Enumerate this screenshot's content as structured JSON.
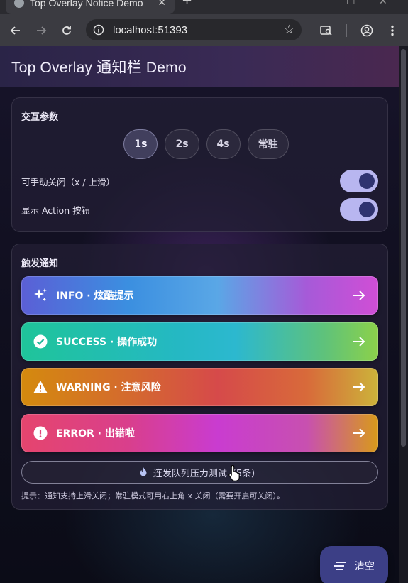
{
  "browser": {
    "tab_title": "Top Overlay Notice Demo",
    "tab_close": "✕",
    "new_tab": "+",
    "url": "localhost:51393"
  },
  "app": {
    "title": "Top Overlay 通知栏 Demo"
  },
  "params_card": {
    "title": "交互参数",
    "durations": [
      {
        "label": "1s",
        "selected": true
      },
      {
        "label": "2s",
        "selected": false
      },
      {
        "label": "4s",
        "selected": false
      },
      {
        "label": "常驻",
        "selected": false
      }
    ],
    "switches": [
      {
        "label": "可手动关闭（x / 上滑）",
        "on": true
      },
      {
        "label": "显示 Action 按钮",
        "on": true
      }
    ]
  },
  "trigger_card": {
    "title": "触发通知",
    "buttons": [
      {
        "label": "INFO · 炫酷提示",
        "icon": "sparkle-icon"
      },
      {
        "label": "SUCCESS · 操作成功",
        "icon": "check-circle-icon"
      },
      {
        "label": "WARNING · 注意风险",
        "icon": "warning-icon"
      },
      {
        "label": "ERROR · 出错啦",
        "icon": "error-icon"
      }
    ],
    "stress_label": "连发队列压力测试（5条）",
    "hint": "提示：通知支持上滑关闭；常驻模式可用右上角 x 关闭（需要开启可关闭）。"
  },
  "fab": {
    "label": "清空"
  },
  "colors": {
    "switch_track": "#b8b6f0",
    "switch_knob": "#2f3370",
    "fab": "#3c3f86"
  }
}
